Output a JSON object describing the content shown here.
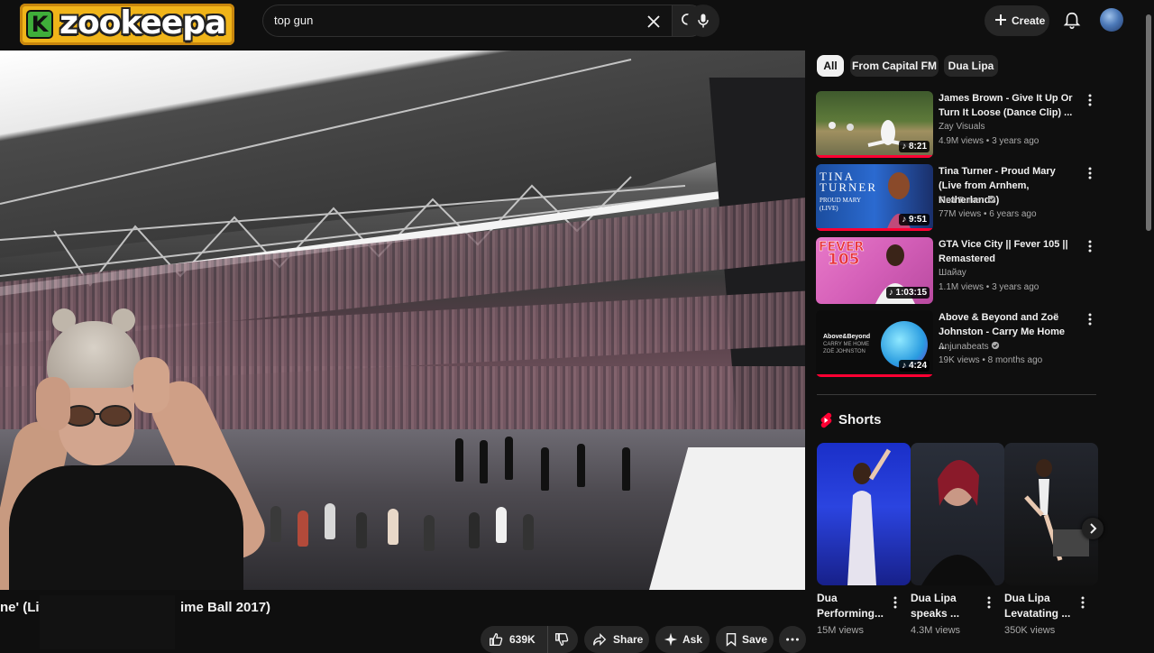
{
  "brand": {
    "logo_letter": "K",
    "logo_text": "zookeepa"
  },
  "header": {
    "search_query": "top gun",
    "create_label": "Create"
  },
  "video": {
    "title_visible": "ne' (Liv",
    "title_visible_end": "ime Ball 2017)",
    "actions": {
      "like_count": "639K",
      "share_label": "Share",
      "ask_label": "Ask",
      "save_label": "Save"
    }
  },
  "filter_chips": [
    "All",
    "From Capital FM",
    "Dua Lipa"
  ],
  "recommendations": [
    {
      "title": "James Brown - Give It Up Or Turn It Loose (Dance Clip) ...",
      "channel": "Zay Visuals",
      "meta": "4.9M views • 3 years ago",
      "duration": "8:21",
      "verified": false
    },
    {
      "title": "Tina Turner - Proud Mary (Live from Arnhem, Netherlands)",
      "channel": "Tina Turner",
      "meta": "77M views • 6 years ago",
      "duration": "9:51",
      "verified": true
    },
    {
      "title": "GTA Vice City || Fever 105 || Remastered",
      "channel": "Шайау",
      "meta": "1.1M views • 3 years ago",
      "duration": "1:03:15",
      "verified": false
    },
    {
      "title": "Above & Beyond and Zoë Johnston - Carry Me Home ...",
      "channel": "Anjunabeats",
      "meta": "19K views • 8 months ago",
      "duration": "4:24",
      "verified": true
    }
  ],
  "thumb_text": {
    "tina_line1": "TINA",
    "tina_line2": "TURNER",
    "tina_line3": "PROUD MARY",
    "tina_line4": "(LIVE)",
    "fever": "FEVER",
    "fever_num": "105",
    "above_line1": "Above&Beyond",
    "above_line2": "CARRY ME HOME",
    "above_line3": "ZOË JOHNSTON"
  },
  "shorts": {
    "section_title": "Shorts",
    "items": [
      {
        "title_line1": "Dua",
        "title_line2": "Performing...",
        "views": "15M views"
      },
      {
        "title_line1": "Dua Lipa",
        "title_line2": "speaks ...",
        "views": "4.3M views"
      },
      {
        "title_line1": "Dua Lipa",
        "title_line2": "Levatating ...",
        "views": "350K views"
      }
    ]
  },
  "colors": {
    "background": "#0f0f0f",
    "accent_red": "#ff0033",
    "chip_bg": "#272727",
    "logo_yellow": "#f0b419"
  }
}
